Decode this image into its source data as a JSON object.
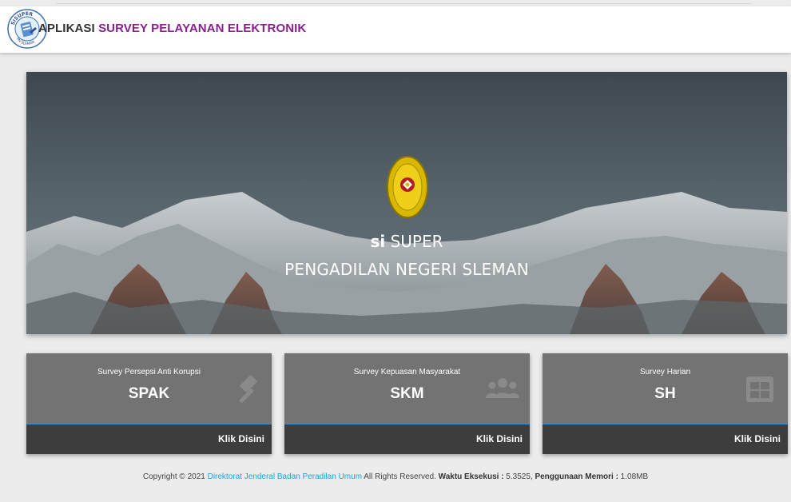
{
  "header": {
    "title_prefix": "APLIKASI",
    "title_rest": " SURVEY PELAYANAN ELEKTRONIK",
    "logo_text": "SISUPER",
    "logo_text_lower": "PN SLEMAN"
  },
  "hero": {
    "title_bold": "si",
    "title_rest": " SUPER",
    "subtitle": "PENGADILAN NEGERI SLEMAN"
  },
  "cards": [
    {
      "caption": "Survey Persepsi Anti Korupsi",
      "abbr": "SPAK",
      "link": "Klik Disini",
      "icon": "gavel-icon"
    },
    {
      "caption": "Survey Kepuasan Masyarakat",
      "abbr": "SKM",
      "link": "Klik Disini",
      "icon": "users-icon"
    },
    {
      "caption": "Survey Harian",
      "abbr": "SH",
      "link": "Klik Disini",
      "icon": "grid-icon"
    }
  ],
  "footer": {
    "copyright_prefix": "Copyright © 2021 ",
    "org_link": "Direktorat Jenderal Badan Peradilan Umum",
    "rights": " All Rights Reserved. ",
    "exec_label": "Waktu Eksekusi :",
    "exec_value": " 5.3525, ",
    "mem_label": "Penggunaan Memori :",
    "mem_value": " 1.08MB"
  },
  "colors": {
    "brand_purple": "#8a1f8f",
    "link_blue": "#1aa3d9",
    "card_bg": "#737373",
    "card_footer": "#3d3d3d"
  }
}
